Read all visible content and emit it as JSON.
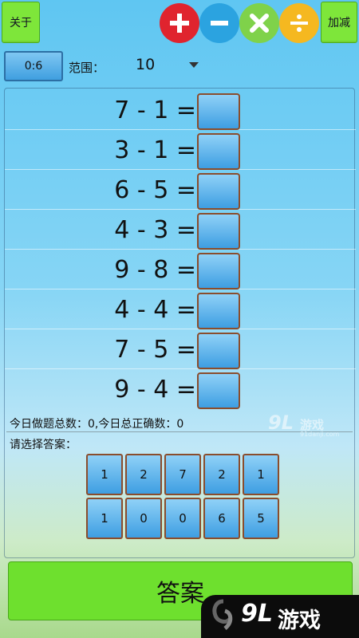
{
  "header": {
    "about_label": "关于",
    "mode_label": "加减",
    "operators": [
      {
        "name": "plus",
        "color": "#e0242e"
      },
      {
        "name": "minus",
        "color": "#2ba3e0"
      },
      {
        "name": "times",
        "color": "#7fd24a"
      },
      {
        "name": "divide",
        "color": "#f5b820"
      }
    ]
  },
  "toolbar": {
    "score": "0:6",
    "range_label": "范围：",
    "range_value": "10"
  },
  "problems": [
    {
      "expr": "7 - 1 ="
    },
    {
      "expr": "3 - 1 ="
    },
    {
      "expr": "6 - 5 ="
    },
    {
      "expr": "4 - 3 ="
    },
    {
      "expr": "9 - 8 ="
    },
    {
      "expr": "4 - 4 ="
    },
    {
      "expr": "7 - 5 ="
    },
    {
      "expr": "9 - 4 ="
    }
  ],
  "stats_text": "今日做题总数：0,今日总正确数：0",
  "choose_label": "请选择答案：",
  "choices": [
    "1",
    "2",
    "7",
    "2",
    "1",
    "1",
    "0",
    "0",
    "6",
    "5"
  ],
  "answer_button_label": "答案",
  "watermark": {
    "mid_big": "9L",
    "mid_text": "游戏",
    "mid_sub": "91danji.com",
    "bottom_big": "9L",
    "bottom_text": "游戏"
  },
  "colors": {
    "green_button": "#7ee63a",
    "answer_box": "#3e9ee2",
    "box_border": "#8a4d2d"
  }
}
